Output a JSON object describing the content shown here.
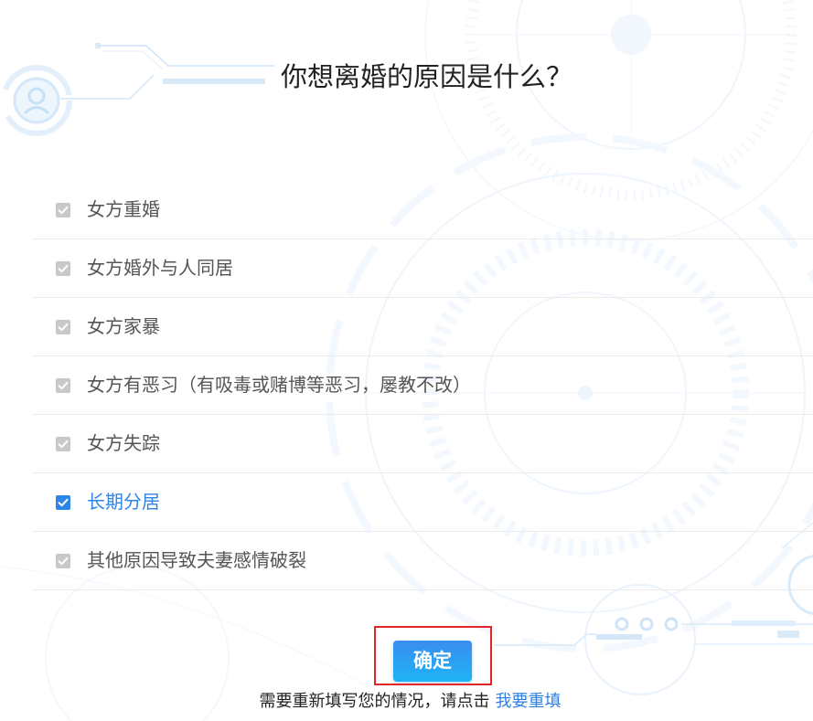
{
  "title": "你想离婚的原因是什么？",
  "options": [
    {
      "label": "女方重婚",
      "checked": true,
      "disabled": true
    },
    {
      "label": "女方婚外与人同居",
      "checked": true,
      "disabled": true
    },
    {
      "label": "女方家暴",
      "checked": true,
      "disabled": true
    },
    {
      "label": "女方有恶习（有吸毒或赌博等恶习，屡教不改）",
      "checked": true,
      "disabled": true
    },
    {
      "label": "女方失踪",
      "checked": true,
      "disabled": true
    },
    {
      "label": "长期分居",
      "checked": true,
      "disabled": false
    },
    {
      "label": "其他原因导致夫妻感情破裂",
      "checked": true,
      "disabled": true
    }
  ],
  "confirm_button": {
    "label": "确定"
  },
  "footer": {
    "prompt": "需要重新填写您的情况，请点击",
    "link_label": "我要重填"
  },
  "icons": {
    "checkbox_mark": "check-icon",
    "decoration": "user-circle-icon"
  },
  "colors": {
    "text": "#222222",
    "option_text": "#555555",
    "accent": "#2e85e8",
    "checkbox_disabled": "#c8c8c8",
    "button_top": "#3a8df0",
    "button_bottom": "#1fb3f5",
    "highlight_box": "#e32626",
    "divider": "#ebebeb",
    "link": "#2f7fe3"
  }
}
